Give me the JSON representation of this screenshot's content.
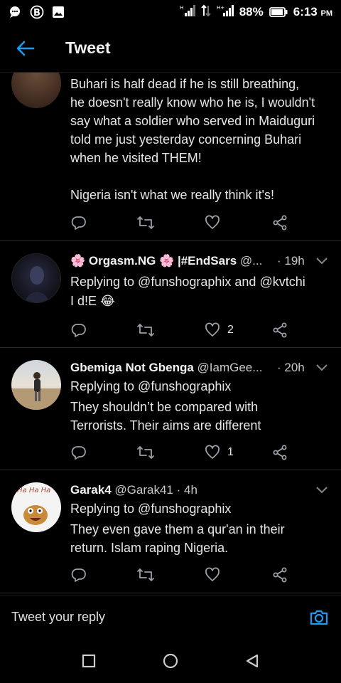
{
  "status_bar": {
    "battery": "88%",
    "time": "6:13",
    "ampm": "PM",
    "icons": [
      "chat-bubble-icon",
      "b-badge-icon",
      "image-icon",
      "signal-h-icon",
      "data-arrows-icon",
      "signal-h-plus-icon",
      "battery-icon"
    ]
  },
  "header": {
    "title": "Tweet",
    "back_icon": "arrow-left-icon"
  },
  "tweets": [
    {
      "text_lines": [
        "Buhari is half dead if he is still breathing,",
        "he doesn't really know who he is, I wouldn't",
        "say what a soldier who served in Maiduguri",
        "told me just yesterday concerning Buhari",
        "when he visited THEM!",
        "",
        "Nigeria isn't what we really think it's!"
      ],
      "likes": ""
    },
    {
      "name": "🌸 Orgasm.NG 🌸 |#EndSars",
      "handle": "@...",
      "time": "· 19h",
      "replying": "Replying to @funshographix and @kvtchi",
      "text": "I d!E 😂",
      "likes": "2"
    },
    {
      "name": "Gbemiga Not Gbenga",
      "handle": "@IamGee...",
      "time": "· 20h",
      "replying": "Replying to @funshographix",
      "text_lines": [
        "They shouldn’t be compared with",
        "Terrorists. Their aims are different"
      ],
      "likes": "1"
    },
    {
      "name": "Garak4",
      "handle": "@Garak41",
      "time": "· 4h",
      "replying": "Replying to @funshographix",
      "text_lines": [
        "They even gave them a qur'an in their",
        "return. Islam raping Nigeria."
      ],
      "likes": ""
    }
  ],
  "reply_bar": {
    "placeholder": "Tweet your reply",
    "camera_icon": "camera-icon"
  },
  "nav_bar": {
    "icons": [
      "recents-square-icon",
      "home-circle-icon",
      "back-triangle-icon"
    ]
  },
  "colors": {
    "background": "#000000",
    "accent": "#1d9bf0",
    "text": "#e6e6e6",
    "icon_gray": "#9aa0a6",
    "divider": "#2a2a2a"
  }
}
